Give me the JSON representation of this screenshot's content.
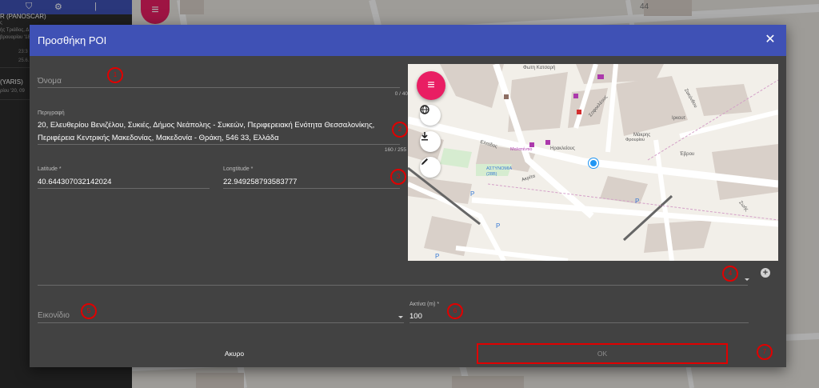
{
  "background": {
    "sidebar": {
      "vehicle1_name": "R (PANOSCAR)",
      "vehicle1_line1": "ς",
      "vehicle1_line2": "ής Τριάδος, Δ",
      "vehicle1_line3": "βρουαρίου '18",
      "vehicle1_time1": "23:3",
      "vehicle1_time2": "25.6.",
      "vehicle2_name": "(YARIS)",
      "vehicle2_sub": "ρίου '20, 09"
    },
    "map_labels": [
      "44"
    ]
  },
  "dialog": {
    "title": "Προσθήκη POI",
    "close_label": "✕",
    "name_field": {
      "placeholder": "Όνομα",
      "counter": "0 / 40"
    },
    "description_field": {
      "label": "Περιγραφή",
      "line1": "20, Ελευθερίου Βενιζέλου, Συκιές, Δήμος Νεάπολης - Συκεών, Περιφερειακή Ενότητα Θεσσαλονίκης,",
      "line2": "Περιφέρεια Κεντρικής Μακεδονίας, Μακεδονία - Θράκη, 546 33, Ελλάδα",
      "counter": "160 / 255"
    },
    "latitude": {
      "label": "Latitude *",
      "value": "40.644307032142024"
    },
    "longitude": {
      "label": "Longtitude *",
      "value": "22.949258793583777"
    },
    "icon_field": {
      "placeholder": "Εικονίδιο"
    },
    "radius_field": {
      "label": "Ακτίνα (m) *",
      "value": "100"
    },
    "cancel_label": "Ακυρο",
    "ok_label": "OK"
  },
  "map": {
    "fab_icon": "menu-icon",
    "layer_button_icon": "globe-icon",
    "download_button_icon": "download-icon",
    "edit_button_icon": "pencil-icon",
    "street_labels": [
      "Φωτη Κατσαρή",
      "Ελπίδος",
      "Ηρακλείους",
      "Ακρίτα",
      "Έβρου",
      "Σοφοκλέους",
      "Μάκρης",
      "Ιρκουτ",
      "Ζακύνθου",
      "Ζωής"
    ],
    "poi_labels": [
      "Μαλατέντιο",
      "ΑΣΤΥΝΟΜΙΑ (28Β)",
      "Φρουρίου"
    ]
  },
  "markers": [
    "1",
    "2",
    "3",
    "4",
    "5",
    "6",
    "7"
  ]
}
